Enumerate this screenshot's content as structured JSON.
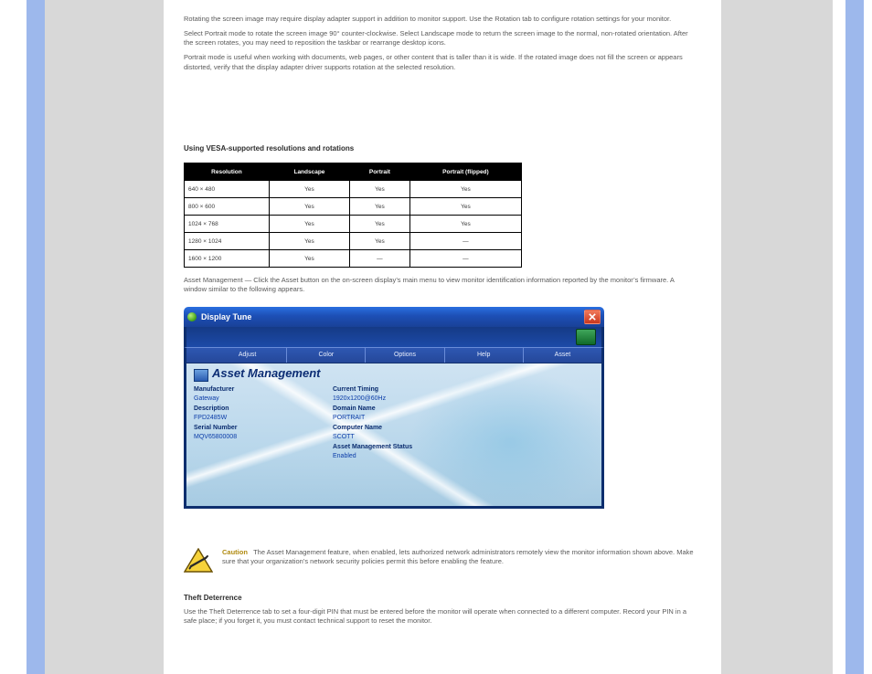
{
  "intro": {
    "p1": "Rotating the screen image may require display adapter support in addition to monitor support. Use the Rotation tab to configure rotation settings for your monitor.",
    "p2": "Select Portrait mode to rotate the screen image 90° counter-clockwise. Select Landscape mode to return the screen image to the normal, non-rotated orientation. After the screen rotates, you may need to reposition the taskbar or rearrange desktop icons.",
    "p3": "Portrait mode is useful when working with documents, web pages, or other content that is taller than it is wide. If the rotated image does not fill the screen or appears distorted, verify that the display adapter driver supports rotation at the selected resolution."
  },
  "table": {
    "heading": "Using VESA-supported resolutions and rotations",
    "headers": [
      "Resolution",
      "Landscape",
      "Portrait",
      "Portrait (flipped)"
    ],
    "rows": [
      [
        "640 × 480",
        "Yes",
        "Yes",
        "Yes"
      ],
      [
        "800 × 600",
        "Yes",
        "Yes",
        "Yes"
      ],
      [
        "1024 × 768",
        "Yes",
        "Yes",
        "Yes"
      ],
      [
        "1280 × 1024",
        "Yes",
        "Yes",
        "—"
      ],
      [
        "1600 × 1200",
        "Yes",
        "—",
        "—"
      ]
    ]
  },
  "asset_intro": "Asset Management — Click the Asset button on the on-screen display’s main menu to view monitor identification information reported by the monitor’s firmware. A window similar to the following appears.",
  "shot": {
    "title": "Display Tune",
    "tabs": [
      "Adjust",
      "Color",
      "Options",
      "Help",
      "Asset"
    ],
    "heading": "Asset Management",
    "left_col": [
      {
        "label": "Manufacturer",
        "value": "Gateway"
      },
      {
        "label": "Description",
        "value": "FPD2485W"
      },
      {
        "label": "Serial Number",
        "value": "MQV65800008"
      }
    ],
    "right_col": [
      {
        "label": "Current Timing",
        "value": "1920x1200@60Hz"
      },
      {
        "label": "Domain Name",
        "value": "PORTRAIT"
      },
      {
        "label": "Computer Name",
        "value": "SCOTT"
      },
      {
        "label": "Asset Management Status",
        "value": "Enabled"
      }
    ]
  },
  "warning": {
    "label": "Caution",
    "text": "The Asset Management feature, when enabled, lets authorized network administrators remotely view the monitor information shown above. Make sure that your organization’s network security policies permit this before enabling the feature."
  },
  "tail": {
    "heading": "Theft Deterrence",
    "body": "Use the Theft Deterrence tab to set a four-digit PIN that must be entered before the monitor will operate when connected to a different computer. Record your PIN in a safe place; if you forget it, you must contact technical support to reset the monitor."
  }
}
